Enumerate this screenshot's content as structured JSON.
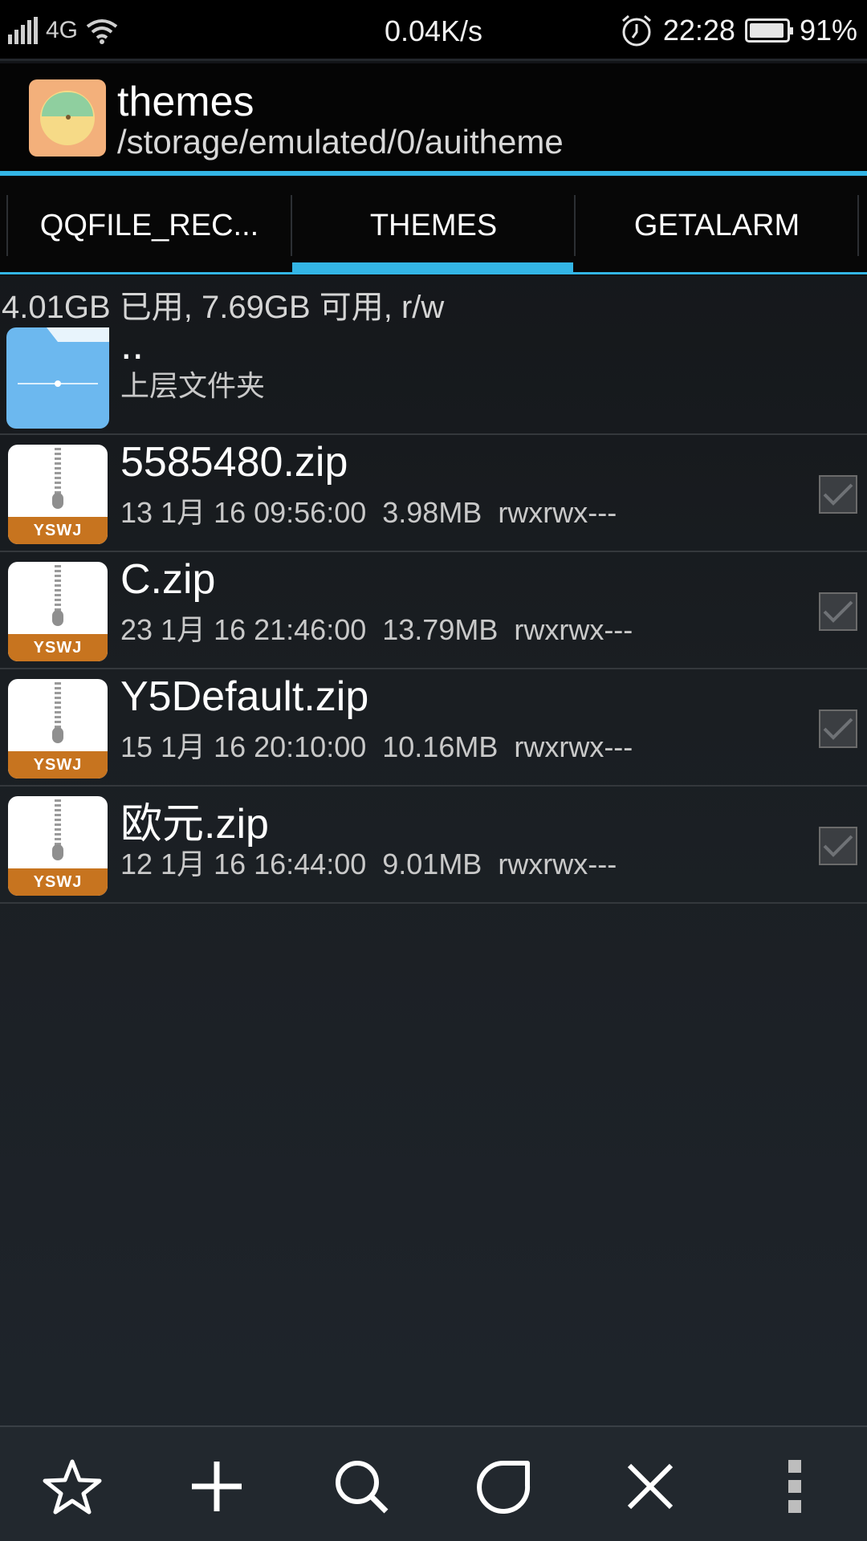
{
  "status_bar": {
    "network": "4G",
    "speed": "0.04K/s",
    "time": "22:28",
    "battery": "91%",
    "battery_level": 0.91
  },
  "header": {
    "title": "themes",
    "path": "/storage/emulated/0/auitheme"
  },
  "tabs": [
    {
      "label": "QQFILE_REC...",
      "selected": false
    },
    {
      "label": "THEMES",
      "selected": true
    },
    {
      "label": "GETALARM",
      "selected": false
    }
  ],
  "storage_info": "4.01GB 已用, 7.69GB 可用, r/w",
  "parent_folder": {
    "name": "..",
    "label": "上层文件夹"
  },
  "files": [
    {
      "name": "5585480.zip",
      "meta": "13 1月 16 09:56:00  3.98MB  rwxrwx---",
      "icon_label": "YSWJ",
      "checked": false
    },
    {
      "name": "C.zip",
      "meta": "23 1月 16 21:46:00  13.79MB  rwxrwx---",
      "icon_label": "YSWJ",
      "checked": false
    },
    {
      "name": "Y5Default.zip",
      "meta": "15 1月 16 20:10:00  10.16MB  rwxrwx---",
      "icon_label": "YSWJ",
      "checked": false
    },
    {
      "name": "欧元.zip",
      "meta": "12 1月 16 16:44:00  9.01MB  rwxrwx---",
      "icon_label": "YSWJ",
      "checked": false
    }
  ],
  "toolbar": {
    "buttons": [
      "star-icon",
      "plus-icon",
      "search-icon",
      "leaf-icon",
      "close-icon",
      "overflow-menu-icon"
    ]
  },
  "colors": {
    "accent": "#33b5e5",
    "zip_band": "#c7741f",
    "folder": "#6cb8ef"
  }
}
